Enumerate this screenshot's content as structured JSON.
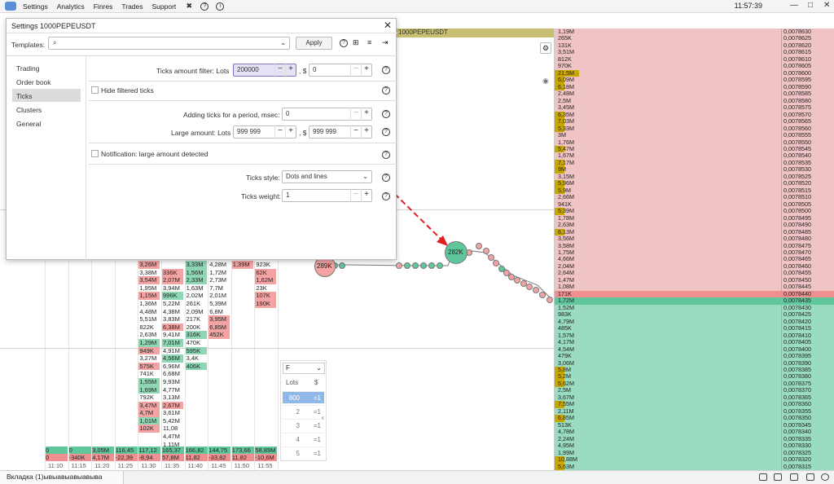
{
  "menu": {
    "items": [
      "Settings",
      "Analytics",
      "Finres",
      "Trades",
      "Support"
    ],
    "clock": "11:57:39"
  },
  "symbol_bar": "1000PEPEUSDT",
  "bottom": {
    "tab": "Вкладка (1)ывыавыавыавыва"
  },
  "dialog": {
    "title": "Settings 1000PEPEUSDT",
    "templates_label": "Templates:",
    "apply": "Apply",
    "sidebar": [
      "Trading",
      "Order book",
      "Ticks",
      "Clusters",
      "General"
    ],
    "ticks_filter_label": "Ticks amount filter: Lots",
    "ticks_filter_lots": "200000",
    "ticks_filter_usd": "0",
    "usd_sep": ", $",
    "hide_filtered": "Hide filtered ticks",
    "adding_label": "Adding ticks for a period, msec:",
    "adding_value": "0",
    "large_label": "Large amount: Lots",
    "large_lots": "999 999",
    "large_usd": "999 999",
    "notification": "Notification: large amount detected",
    "style_label": "Ticks style:",
    "style_value": "Dots and lines",
    "weight_label": "Ticks weight:",
    "weight_value": "1"
  },
  "lots_box": {
    "filter": "F",
    "col_lots": "Lots",
    "col_usd": "$",
    "rows": [
      [
        "800",
        "=1"
      ],
      [
        "2",
        "=1"
      ],
      [
        "3",
        "=1"
      ],
      [
        "4",
        "=1"
      ],
      [
        "5",
        "=1"
      ]
    ]
  },
  "bubbles": {
    "left": "289K",
    "center": "282K"
  },
  "columns": [
    {
      "cells": []
    },
    {
      "cells": []
    },
    {
      "cells": []
    },
    {
      "cells": []
    },
    {
      "cells": [
        [
          "3,26M",
          "r"
        ],
        [
          "3,38M",
          "w"
        ],
        [
          "3,54M",
          "r"
        ],
        [
          "1,95M",
          "w"
        ],
        [
          "1,15M",
          "r"
        ],
        [
          "1,36M",
          "w"
        ],
        [
          "4,48M",
          "w"
        ],
        [
          "5,51M",
          "w"
        ],
        [
          "822K",
          "w"
        ],
        [
          "2,63M",
          "w"
        ],
        [
          "1,29M",
          "g"
        ],
        [
          "949K",
          "r"
        ],
        [
          "3,27M",
          "w"
        ],
        [
          "575K",
          "r"
        ],
        [
          "741K",
          "w"
        ],
        [
          "1,55M",
          "g"
        ],
        [
          "1,69M",
          "g"
        ],
        [
          "792K",
          "w"
        ],
        [
          "3,47M",
          "r"
        ],
        [
          "4,7M",
          "r"
        ],
        [
          "1,01M",
          "g"
        ],
        [
          "102K",
          "r"
        ]
      ]
    },
    {
      "cells": [
        [
          "",
          "w"
        ],
        [
          "336K",
          "r"
        ],
        [
          "2,07M",
          "r"
        ],
        [
          "3,94M",
          "w"
        ],
        [
          "996K",
          "g"
        ],
        [
          "5,22M",
          "w"
        ],
        [
          "4,38M",
          "w"
        ],
        [
          "3,83M",
          "w"
        ],
        [
          "6,38M",
          "r"
        ],
        [
          "9,41M",
          "w"
        ],
        [
          "7,01M",
          "g"
        ],
        [
          "4,91M",
          "w"
        ],
        [
          "4,56M",
          "g"
        ],
        [
          "6,96M",
          "w"
        ],
        [
          "6,68M",
          "w"
        ],
        [
          "9,93M",
          "w"
        ],
        [
          "4,77M",
          "w"
        ],
        [
          "3,13M",
          "w"
        ],
        [
          "2,67M",
          "r"
        ],
        [
          "3,61M",
          "w"
        ],
        [
          "5,42M",
          "w"
        ],
        [
          "11,08",
          "w"
        ],
        [
          "4,47M",
          "w"
        ],
        [
          "1,11M",
          "w"
        ],
        [
          "1,57M",
          "w"
        ]
      ]
    },
    {
      "cells": [
        [
          "3,33M",
          "g"
        ],
        [
          "1,56M",
          "g"
        ],
        [
          "2,33M",
          "g"
        ],
        [
          "1,63M",
          "w"
        ],
        [
          "2,02M",
          "w"
        ],
        [
          "261K",
          "w"
        ],
        [
          "2,09M",
          "w"
        ],
        [
          "217K",
          "w"
        ],
        [
          "200K",
          "w"
        ],
        [
          "316K",
          "g"
        ],
        [
          "470K",
          "w"
        ],
        [
          "595K",
          "g"
        ],
        [
          "3,4K",
          "w"
        ],
        [
          "406K",
          "g"
        ]
      ]
    },
    {
      "cells": [
        [
          "4,28M",
          "w"
        ],
        [
          "1,72M",
          "w"
        ],
        [
          "2,73M",
          "w"
        ],
        [
          "7,7M",
          "w"
        ],
        [
          "2,01M",
          "w"
        ],
        [
          "5,39M",
          "w"
        ],
        [
          "6,8M",
          "w"
        ],
        [
          "3,95M",
          "r"
        ],
        [
          "6,85M",
          "r"
        ],
        [
          "452K",
          "r"
        ]
      ]
    },
    {
      "cells": [
        [
          "1,39M",
          "r"
        ]
      ]
    },
    {
      "cells": [
        [
          "923K",
          "w"
        ],
        [
          "62K",
          "r"
        ],
        [
          "1,62M",
          "r"
        ],
        [
          "23K",
          "w"
        ],
        [
          "107K",
          "r"
        ],
        [
          "190K",
          "r"
        ]
      ]
    }
  ],
  "col_bottom": [
    [
      "0",
      "0"
    ],
    [
      "0",
      "-340K"
    ],
    [
      "3,05M",
      "4,17M"
    ],
    [
      "116,45",
      "-22,39"
    ],
    [
      "117,12",
      "-8,94"
    ],
    [
      "165,37",
      "57,8M"
    ],
    [
      "166,82",
      "11,82"
    ],
    [
      "144,75",
      "-33,82"
    ],
    [
      "173,66",
      "11,82"
    ],
    [
      "58,89M",
      "-10,6M"
    ]
  ],
  "times": [
    "11:10",
    "11:15",
    "11:20",
    "11:25",
    "11:30",
    "11:35",
    "11:40",
    "11:45",
    "11:50",
    "11:55"
  ],
  "scale": [
    [
      "1,19M",
      "0,0078630"
    ],
    [
      "265K",
      "0,0078625"
    ],
    [
      "131K",
      "0,0078620"
    ],
    [
      "3,51M",
      "0,0078615"
    ],
    [
      "812K",
      "0,0078610"
    ],
    [
      "970K",
      "0,0078605"
    ],
    [
      "21,5M",
      "0,0078600"
    ],
    [
      "6,09M",
      "0,0078595"
    ],
    [
      "6,18M",
      "0,0078590"
    ],
    [
      "2,48M",
      "0,0078585"
    ],
    [
      "2,5M",
      "0,0078580"
    ],
    [
      "3,45M",
      "0,0078575"
    ],
    [
      "6,35M",
      "0,0078570"
    ],
    [
      "7,03M",
      "0,0078565"
    ],
    [
      "5,33M",
      "0,0078560"
    ],
    [
      "3M",
      "0,0078555"
    ],
    [
      "1,76M",
      "0,0078550"
    ],
    [
      "5,47M",
      "0,0078545"
    ],
    [
      "1,67M",
      "0,0078540"
    ],
    [
      "7,17M",
      "0,0078535"
    ],
    [
      "9M",
      "0,0078530"
    ],
    [
      "3,15M",
      "0,0078525"
    ],
    [
      "5,96M",
      "0,0078520"
    ],
    [
      "5,9M",
      "0,0078515"
    ],
    [
      "2,66M",
      "0,0078510"
    ],
    [
      "941K",
      "0,0078505"
    ],
    [
      "5,39M",
      "0,0078500"
    ],
    [
      "1,78M",
      "0,0078495"
    ],
    [
      "2,63M",
      "0,0078490"
    ],
    [
      "6,13M",
      "0,0078485"
    ],
    [
      "3,56M",
      "0,0078480"
    ],
    [
      "3,58M",
      "0,0078475"
    ],
    [
      "1,75M",
      "0,0078470"
    ],
    [
      "4,66M",
      "0,0078465"
    ],
    [
      "2,04M",
      "0,0078460"
    ],
    [
      "2,64M",
      "0,0078455"
    ],
    [
      "1,47M",
      "0,0078450"
    ],
    [
      "1,08M",
      "0,0078445"
    ],
    [
      "171K",
      "0,0078440"
    ],
    [
      "1,72M",
      "0,0078435"
    ],
    [
      "1,52M",
      "0,0078430"
    ],
    [
      "983K",
      "0,0078425"
    ],
    [
      "4,79M",
      "0,0078420"
    ],
    [
      "485K",
      "0,0078415"
    ],
    [
      "1,57M",
      "0,0078410"
    ],
    [
      "4,17M",
      "0,0078405"
    ],
    [
      "4,54M",
      "0,0078400"
    ],
    [
      "479K",
      "0,0078395"
    ],
    [
      "3,06M",
      "0,0078390"
    ],
    [
      "5,8M",
      "0,0078385"
    ],
    [
      "5,2M",
      "0,0078380"
    ],
    [
      "5,62M",
      "0,0078375"
    ],
    [
      "2,5M",
      "0,0078370"
    ],
    [
      "3,67M",
      "0,0078365"
    ],
    [
      "7,55M",
      "0,0078360"
    ],
    [
      "2,11M",
      "0,0078355"
    ],
    [
      "6,85M",
      "0,0078350"
    ],
    [
      "513K",
      "0,0078345"
    ],
    [
      "4,78M",
      "0,0078340"
    ],
    [
      "2,24M",
      "0,0078335"
    ],
    [
      "4,95M",
      "0,0078330"
    ],
    [
      "1,99M",
      "0,0078325"
    ],
    [
      "10,88M",
      "0,0078320"
    ],
    [
      "5,63M",
      "0,0078315"
    ]
  ],
  "colors": {
    "ask": "#f0c4c4",
    "bid": "#9adcc0",
    "ask_dark": "#f08f8f",
    "bid_dark": "#5fc79b",
    "volume": "#c8a800",
    "arrow": "#e02020"
  }
}
